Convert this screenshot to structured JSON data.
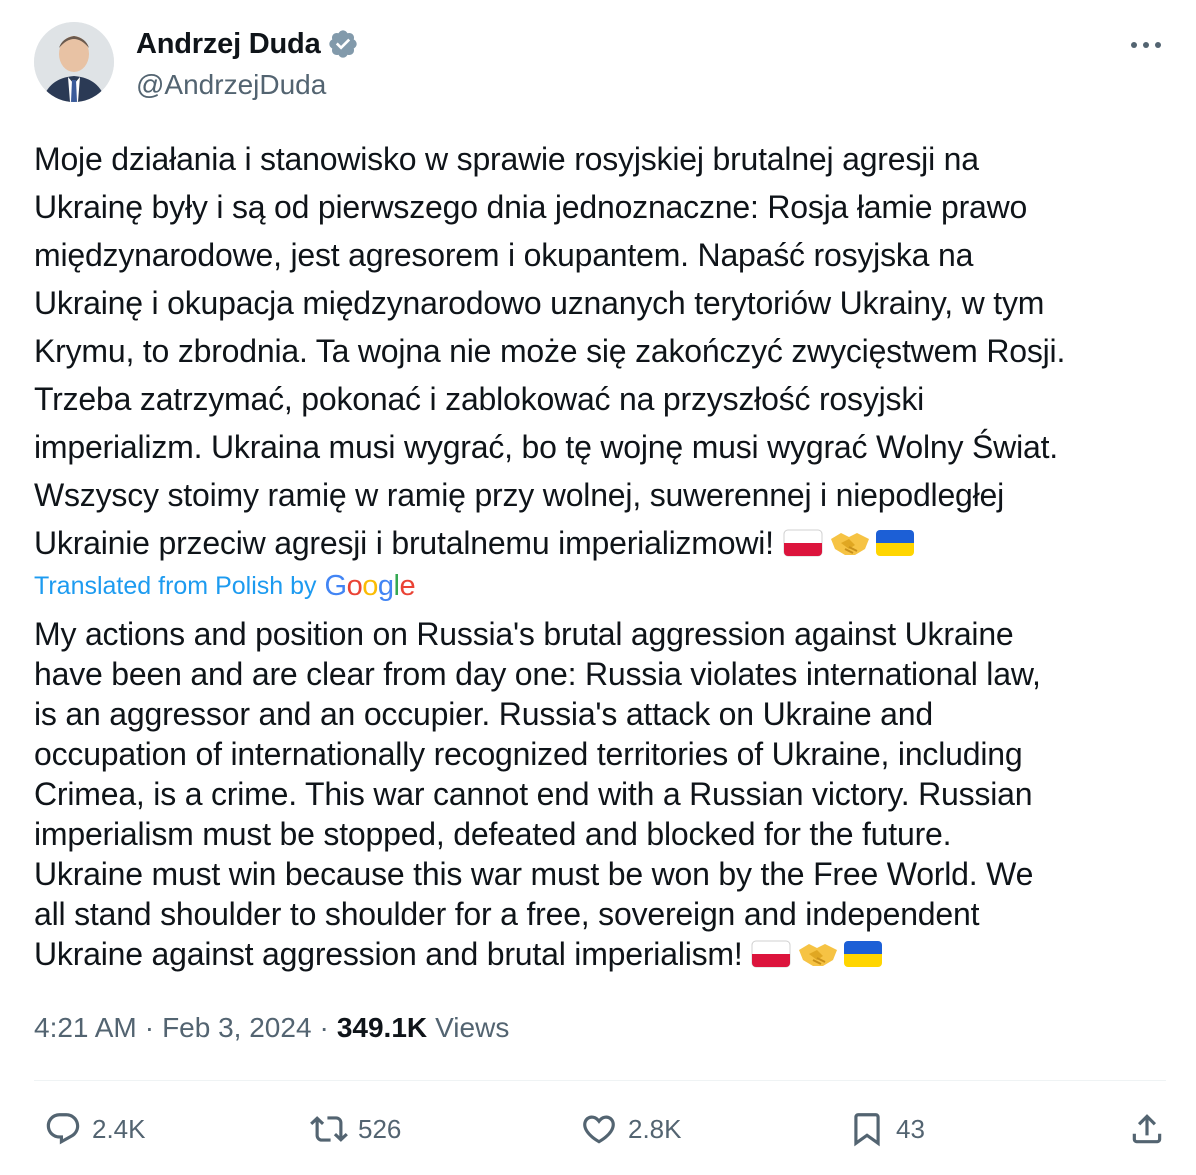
{
  "author": {
    "display_name": "Andrzej Duda",
    "handle": "@AndrzejDuda",
    "verified_icon": "verified-badge-icon"
  },
  "tweet": {
    "text": "Moje działania i stanowisko w sprawie rosyjskiej brutalnej agresji na\nUkrainę były i są od pierwszego dnia jednoznaczne:  Rosja łamie prawo\nmiędzynarodowe, jest agresorem i okupantem. Napaść rosyjska na\nUkrainę i okupacja międzynarodowo uznanych terytoriów Ukrainy, w tym\nKrymu, to zbrodnia. Ta wojna nie może się zakończyć zwycięstwem Rosji.\nTrzeba zatrzymać, pokonać i zablokować na przyszłość rosyjski\nimperializm. Ukraina musi wygrać, bo tę wojnę musi wygrać Wolny Świat.\nWszyscy stoimy ramię w ramię przy wolnej, suwerennej i niepodległej\nUkrainie przeciw agresji i brutalnemu imperializmowi! ",
    "translated_label": "Translated from Polish by",
    "translator_brand": "Google",
    "translated_text": "My actions and position on Russia's brutal aggression against Ukraine\nhave been and are clear from day one: Russia violates international law,\nis an aggressor and an occupier. Russia's attack on Ukraine and\noccupation of internationally recognized territories of Ukraine, including\nCrimea, is a crime. This war cannot end with a Russian victory. Russian\nimperialism must be stopped, defeated and blocked for the future.\nUkraine must win because this war must be won by the Free World. We\nall stand shoulder to shoulder for a free, sovereign and independent\nUkraine against aggression and brutal imperialism! ",
    "emojis": [
      "poland-flag",
      "handshake",
      "ukraine-flag"
    ]
  },
  "meta": {
    "time": "4:21 AM",
    "separator": "·",
    "date": "Feb 3, 2024",
    "views_count": "349.1K",
    "views_label": "Views"
  },
  "actions": {
    "replies": "2.4K",
    "reposts": "526",
    "likes": "2.8K",
    "bookmarks": "43"
  },
  "colors": {
    "text_primary": "#0f1419",
    "text_secondary": "#536471",
    "accent": "#1d9bf0",
    "divider": "#eff3f4"
  }
}
